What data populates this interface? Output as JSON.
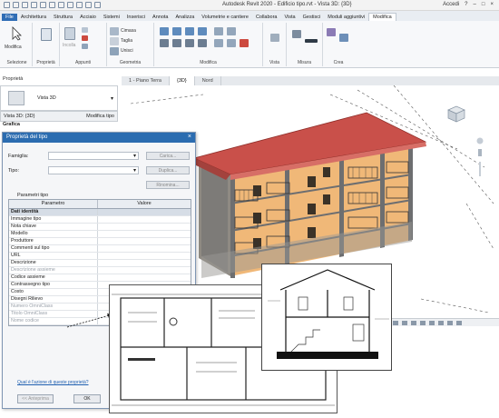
{
  "window": {
    "title": "Autodesk Revit 2020 - Edificio tipo.rvt - Vista 3D: {3D}",
    "user": "Accedi",
    "help": "?"
  },
  "ribbon_tabs": [
    "File",
    "Architettura",
    "Struttura",
    "Acciaio",
    "Sistemi",
    "Inserisci",
    "Annota",
    "Analizza",
    "Volumetrie e cantiere",
    "Collabora",
    "Vista",
    "Gestisci",
    "Moduli aggiuntivi",
    "Modifica"
  ],
  "ribbon": {
    "modify_button": "Modifica",
    "group_labels": [
      "Selezione",
      "Proprietà",
      "Appunti",
      "Geometria",
      "Modifica",
      "Vista",
      "Misura",
      "Crea"
    ],
    "clipboard_items": [
      "Incolla",
      "Copia",
      "Taglia",
      "Unisci"
    ],
    "geometry_items": [
      "Cimasa",
      "Taglia",
      "Unisci"
    ]
  },
  "properties_palette": {
    "header": "Proprietà",
    "type_name": "Vista 3D",
    "selector": "Vista 3D: {3D}",
    "edit_type": "Modifica tipo",
    "section": "Grafica"
  },
  "view_tabs": [
    "1 - Piano Terra",
    "{3D}",
    "Nord"
  ],
  "dialog": {
    "title": "Proprietà del tipo",
    "close": "×",
    "family_label": "Famiglia:",
    "type_label": "Tipo:",
    "load_btn": "Carica...",
    "duplicate_btn": "Duplica...",
    "rename_btn": "Rinomina...",
    "params_label": "Parametri tipo",
    "col_param": "Parametro",
    "col_value": "Valore",
    "rows": [
      {
        "name": "Dati identità",
        "group": true
      },
      {
        "name": "Immagine tipo"
      },
      {
        "name": "Nota chiave"
      },
      {
        "name": "Modello"
      },
      {
        "name": "Produttore"
      },
      {
        "name": "Commenti sul tipo"
      },
      {
        "name": "URL"
      },
      {
        "name": "Descrizione"
      },
      {
        "name": "Descrizione assieme",
        "muted": true
      },
      {
        "name": "Codice assieme"
      },
      {
        "name": "Contrassegno tipo"
      },
      {
        "name": "Costo"
      },
      {
        "name": "Disegni Rilievo"
      },
      {
        "name": "Numero OmniClass",
        "muted": true
      },
      {
        "name": "Titolo OmniClass",
        "muted": true
      },
      {
        "name": "Nome codice",
        "muted": true
      }
    ],
    "help_link": "Qual è l'azione di queste proprietà?",
    "preview_btn": "<< Anteprima",
    "ok_btn": "OK"
  },
  "colors": {
    "roof": "#c9504a",
    "facade": "#f0b878",
    "frame": "#6d6e70",
    "accent": "#2b6cb0"
  }
}
